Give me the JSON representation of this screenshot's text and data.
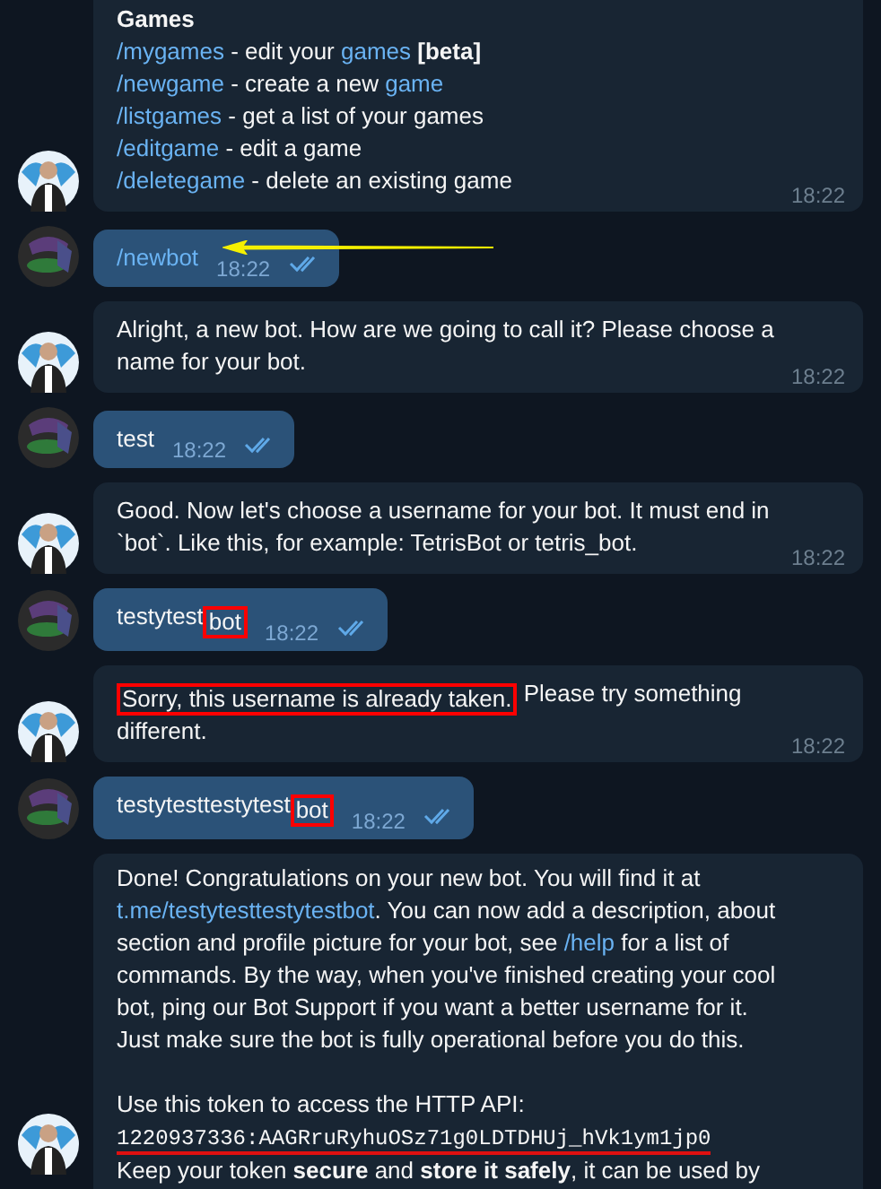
{
  "messages": [
    {
      "kind": "incoming",
      "time": "18:22",
      "blocks": [
        [
          [
            {
              "t": "Games",
              "kind": "bold"
            }
          ],
          [
            {
              "t": "/mygames",
              "kind": "link"
            },
            {
              "t": " - edit your ",
              "kind": "plain"
            },
            {
              "t": "games",
              "kind": "link"
            },
            {
              "t": " [beta]",
              "kind": "bold"
            }
          ],
          [
            {
              "t": "/newgame",
              "kind": "link"
            },
            {
              "t": " - create a new ",
              "kind": "plain"
            },
            {
              "t": "game",
              "kind": "link"
            }
          ],
          [
            {
              "t": "/listgames",
              "kind": "link"
            },
            {
              "t": " - get a list of your games",
              "kind": "plain"
            }
          ],
          [
            {
              "t": "/editgame",
              "kind": "link"
            },
            {
              "t": " - edit a game",
              "kind": "plain"
            }
          ],
          [
            {
              "t": "/deletegame",
              "kind": "link"
            },
            {
              "t": " - delete an existing game",
              "kind": "plain"
            }
          ]
        ]
      ]
    },
    {
      "kind": "outgoing",
      "time": "18:22",
      "read": true,
      "arrow": true,
      "segments": [
        {
          "t": "/newbot",
          "kind": "link"
        }
      ]
    },
    {
      "kind": "incoming",
      "time": "18:22",
      "blocks": [
        [
          [
            {
              "t": "Alright, a new bot. How are we going to call it? Please choose a name for your bot.",
              "kind": "plain"
            }
          ]
        ]
      ]
    },
    {
      "kind": "outgoing",
      "time": "18:22",
      "read": true,
      "arrow": false,
      "segments": [
        {
          "t": "test",
          "kind": "plain"
        }
      ]
    },
    {
      "kind": "incoming",
      "time": "18:22",
      "blocks": [
        [
          [
            {
              "t": "Good. Now let's choose a username for your bot. It must end in `bot`. Like this, for example: TetrisBot or tetris_bot.",
              "kind": "plain"
            }
          ]
        ]
      ]
    },
    {
      "kind": "outgoing",
      "time": "18:22",
      "read": true,
      "arrow": false,
      "segments": [
        {
          "t": "testytest",
          "kind": "plain"
        },
        {
          "t": "bot",
          "kind": "plain",
          "boxed": true
        }
      ]
    },
    {
      "kind": "incoming",
      "time": "18:22",
      "blocks": [
        [
          [
            {
              "t": "Sorry, this username is already taken.",
              "kind": "plain",
              "boxed": true
            },
            {
              "t": " Please try something different.",
              "kind": "plain"
            }
          ]
        ]
      ]
    },
    {
      "kind": "outgoing",
      "time": "18:22",
      "read": true,
      "arrow": false,
      "segments": [
        {
          "t": "testytesttestytest",
          "kind": "plain"
        },
        {
          "t": "bot",
          "kind": "plain",
          "boxed": true
        }
      ]
    },
    {
      "kind": "incoming",
      "blocks": [
        [
          [
            {
              "t": "Done! Congratulations on your new bot. You will find it at ",
              "kind": "plain"
            },
            {
              "t": "t.me/testytesttestytestbot",
              "kind": "link"
            },
            {
              "t": ". You can now add a description, about section and profile picture for your bot, see ",
              "kind": "plain"
            },
            {
              "t": "/help",
              "kind": "link"
            },
            {
              "t": " for a list of commands. By the way, when you've finished creating your cool bot, ping our Bot Support if you want a better username for it. Just make sure the bot is fully operational before you do this.",
              "kind": "plain"
            }
          ]
        ],
        [
          [
            {
              "t": "Use this token to access the HTTP API:",
              "kind": "plain"
            }
          ],
          [
            {
              "t": "1220937336:AAGRruRyhuOSz71g0LDTDHUj_hVk1ym1jp0",
              "kind": "code",
              "underlined": true
            }
          ],
          [
            {
              "t": "Keep your token ",
              "kind": "plain"
            },
            {
              "t": "secure",
              "kind": "bold"
            },
            {
              "t": " and ",
              "kind": "plain"
            },
            {
              "t": "store it safely",
              "kind": "bold"
            },
            {
              "t": ", it can be used by",
              "kind": "plain"
            }
          ]
        ]
      ]
    }
  ]
}
